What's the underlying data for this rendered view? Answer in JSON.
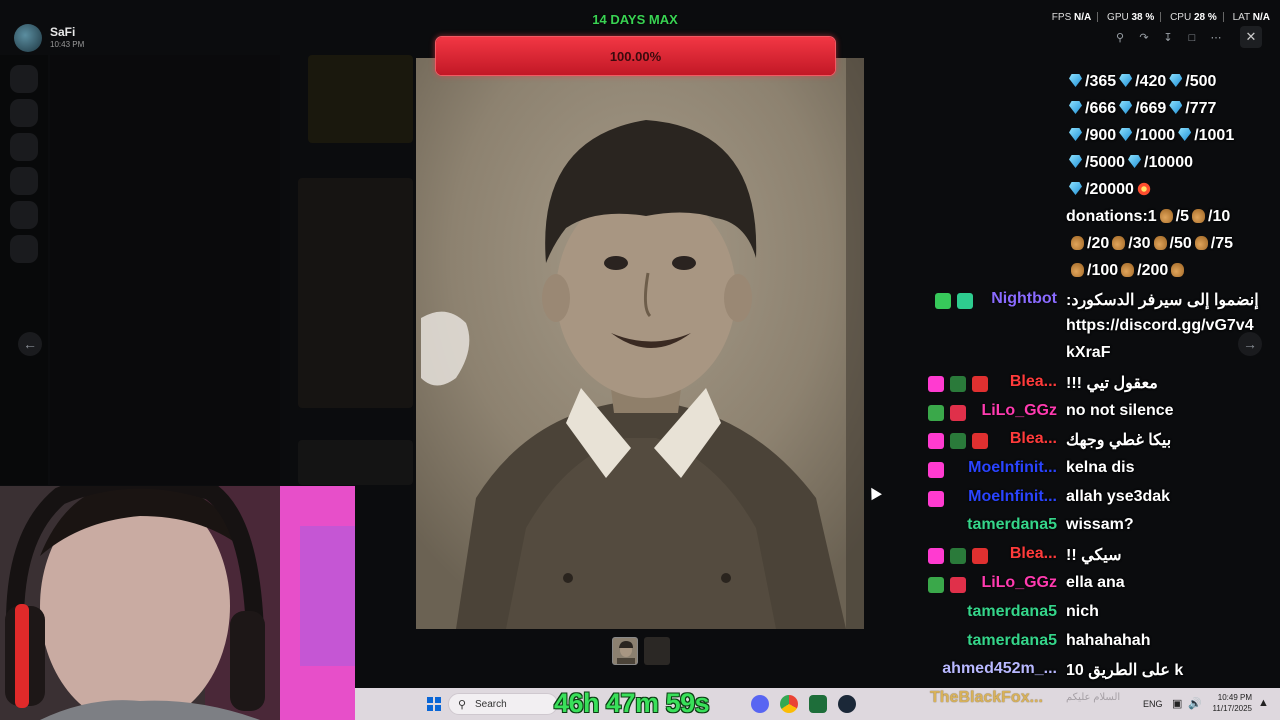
{
  "app": {
    "name": "SaFi",
    "time": "10:43 PM"
  },
  "stats": {
    "fps_label": "FPS",
    "fps": "N/A",
    "gpu_label": "GPU",
    "gpu": "38 %",
    "cpu_label": "CPU",
    "cpu": "28 %",
    "lat_label": "LAT",
    "lat": "N/A"
  },
  "goal": {
    "title": "14 DAYS MAX",
    "percent_text": "100.00%",
    "fill": 1.0
  },
  "chat": {
    "donation_lines": [
      [
        "/365",
        "/420",
        "/500"
      ],
      [
        "/666",
        "/669",
        "/777"
      ],
      [
        "/900",
        "/1000",
        "/1001"
      ],
      [
        "/5000",
        "/10000"
      ],
      [
        "/20000"
      ]
    ],
    "donations_label": "donations:1",
    "bag_row1": [
      "/5",
      "/10"
    ],
    "bag_row2": [
      "/20",
      "/30",
      "/50",
      "/75"
    ],
    "bag_row3": [
      "/100",
      "/200"
    ],
    "messages": [
      {
        "user": "Nightbot",
        "color": "#8a6bff",
        "text": ":إنضموا إلى سيرفر الدسكورد",
        "text2": "https://discord.gg/vG7v4",
        "text3": "kXraF",
        "badges": [
          "#37c95a",
          "#2ecc8f"
        ]
      },
      {
        "user": "Blea...",
        "color": "#ff3b3b",
        "text": "!!! معقول تيي",
        "badges": [
          "#ff3bd0",
          "#2a7a3a",
          "#e03030"
        ]
      },
      {
        "user": "LiLo_GGz",
        "color": "#ff3bb0",
        "text": "no not silence",
        "badges": [
          "#3aa84a",
          "#e0304a"
        ]
      },
      {
        "user": "Blea...",
        "color": "#ff3b3b",
        "text": "بيكا غطي وجهك",
        "badges": [
          "#ff3bd0",
          "#2a7a3a",
          "#e03030"
        ]
      },
      {
        "user": "MoeInfinit...",
        "color": "#2a44ff",
        "text": "kelna dis",
        "badges": [
          "#ff3bd0"
        ]
      },
      {
        "user": "MoeInfinit...",
        "color": "#2a44ff",
        "text": "allah yse3dak",
        "badges": [
          "#ff3bd0"
        ]
      },
      {
        "user": "tamerdana5",
        "color": "#35d58a",
        "text": "wissam?",
        "badges": []
      },
      {
        "user": "Blea...",
        "color": "#ff3b3b",
        "text": "!! سيكي",
        "badges": [
          "#ff3bd0",
          "#2a7a3a",
          "#e03030"
        ]
      },
      {
        "user": "LiLo_GGz",
        "color": "#ff3bb0",
        "text": "ella ana",
        "badges": [
          "#3aa84a",
          "#e0304a"
        ]
      },
      {
        "user": "tamerdana5",
        "color": "#35d58a",
        "text": "nich",
        "badges": []
      },
      {
        "user": "tamerdana5",
        "color": "#35d58a",
        "text": "hahahahah",
        "badges": []
      },
      {
        "user": "ahmed452m_...",
        "color": "#b8b8ff",
        "text": "على الطريق 10 k",
        "badges": []
      }
    ]
  },
  "taskbar": {
    "search_placeholder": "Search",
    "timer": "46h 47m 59s",
    "channel_name": "TheBlackFox...",
    "arabic_tray": "السلام عليكم",
    "lang": "ENG",
    "clock_time": "10:49 PM",
    "clock_date": "11/17/2025"
  },
  "icons": [
    "search-icon",
    "share-icon",
    "download-icon",
    "open-external-icon",
    "more-icon",
    "close-icon",
    "arrow-left-icon",
    "arrow-right-icon",
    "windows-icon",
    "discord-icon",
    "chrome-icon",
    "steam-icon",
    "diamond-icon",
    "money-bag-icon"
  ]
}
